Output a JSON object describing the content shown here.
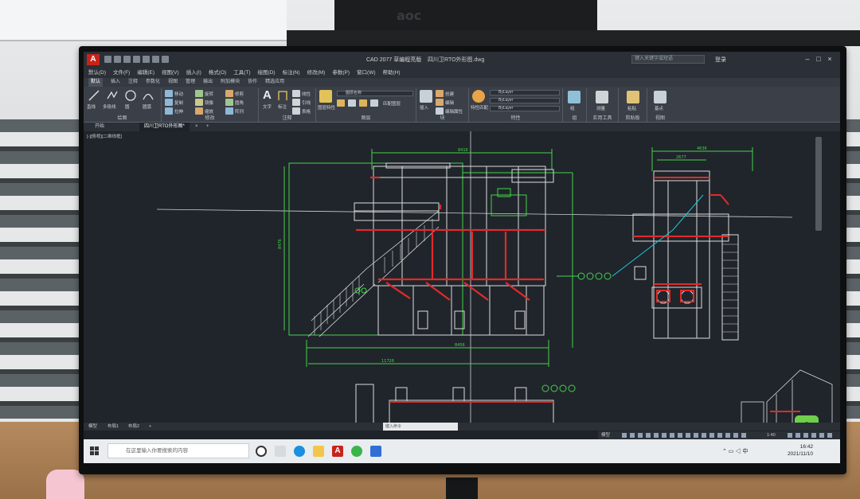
{
  "app": {
    "title_app": "CAD 2077  草编程亮版",
    "title_file": "四川卫RTO外形图.dwg",
    "search_placeholder": "键入关键字或短语",
    "user": "登录",
    "logo": "A"
  },
  "menu": [
    "默认(D)",
    "文件(F)",
    "编辑(E)",
    "视图(V)",
    "插入(I)",
    "格式(O)",
    "工具(T)",
    "绘图(D)",
    "标注(N)",
    "修改(M)",
    "参数(P)",
    "窗口(W)",
    "帮助(H)"
  ],
  "ribbon_tabs": [
    "默认",
    "插入",
    "注释",
    "参数化",
    "视图",
    "管理",
    "输出",
    "附加模块",
    "协作",
    "精选应用"
  ],
  "ribbon": {
    "draw": {
      "title": "绘图",
      "line": "直线",
      "polyline": "多段线",
      "circle": "圆",
      "arc": "圆弧"
    },
    "modify": {
      "title": "修改",
      "move": "移动",
      "rotate": "旋转",
      "trim": "修剪",
      "copy": "复制",
      "mirror": "镜像",
      "fillet": "圆角",
      "stretch": "拉伸",
      "scale": "缩放",
      "array": "阵列"
    },
    "annotation": {
      "title": "注释",
      "text": "文字",
      "dim": "标注",
      "linear": "线性",
      "leader": "引线",
      "table": "表格"
    },
    "layers": {
      "title": "图层",
      "layer_props": "图层特性",
      "current_layer": "图层名称",
      "match": "匹配图层"
    },
    "block": {
      "title": "块",
      "insert": "插入",
      "create": "创建",
      "edit": "编辑",
      "attr": "编辑属性"
    },
    "properties": {
      "title": "特性",
      "match": "特性匹配",
      "bylayer1": "ByLayer",
      "bylayer2": "ByLayer",
      "bylayer3": "ByLayer"
    },
    "groups": {
      "title": "组",
      "group": "组"
    },
    "utilities": {
      "title": "实用工具",
      "measure": "测量"
    },
    "clipboard": {
      "title": "剪贴板",
      "paste": "粘贴"
    },
    "view": {
      "title": "视图",
      "base": "基点"
    }
  },
  "file_tabs": [
    "开始",
    "四川卫RTO外形图*"
  ],
  "viewport_label": "[-][俯视][二维线框]",
  "dimensions": {
    "top_left": "8416",
    "top_right": "4636",
    "top_right_inner": "2677",
    "bottom_inner": "8456",
    "bottom_outer": "11726",
    "vertical": "8476"
  },
  "layout_tabs": [
    "模型",
    "布局1",
    "布局2",
    "+"
  ],
  "command_prompt": "键入命令",
  "status": {
    "mode": "模型",
    "scale": "1:40"
  },
  "taskbar": {
    "search": "在这里输入你要搜索的内容",
    "time": "16:42",
    "date": "2021/11/10"
  },
  "colors": {
    "cad_bg": "#20252b",
    "green": "#45d24a",
    "red": "#e02b2b",
    "white_line": "#dcdcdc",
    "cyan": "#1ec8d8",
    "yellow": "#f0e436"
  },
  "background": {
    "monitor_brand": "aoc"
  }
}
